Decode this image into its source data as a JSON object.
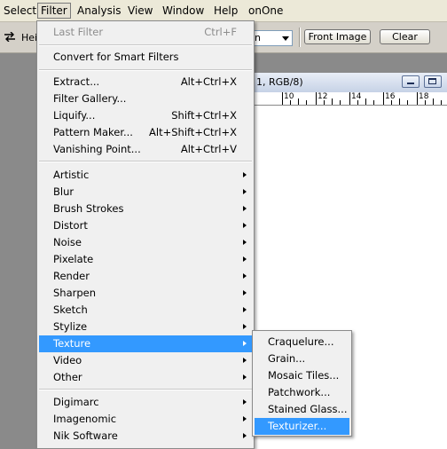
{
  "menubar": [
    "Select",
    "Filter",
    "Analysis",
    "View",
    "Window",
    "Help",
    "onOne"
  ],
  "options": {
    "label_partial": "Hei",
    "select_value_partial": "n",
    "front_image": "Front Image",
    "clear": "Clear"
  },
  "document": {
    "title_partial": "1, RGB/8)",
    "ruler_ticks": [
      "10",
      "12",
      "14",
      "16",
      "18"
    ]
  },
  "filter_menu": {
    "last_filter": {
      "label": "Last Filter",
      "shortcut": "Ctrl+F"
    },
    "convert": "Convert for Smart Filters",
    "group1": [
      {
        "label": "Extract...",
        "shortcut": "Alt+Ctrl+X"
      },
      {
        "label": "Filter Gallery...",
        "shortcut": ""
      },
      {
        "label": "Liquify...",
        "shortcut": "Shift+Ctrl+X"
      },
      {
        "label": "Pattern Maker...",
        "shortcut": "Alt+Shift+Ctrl+X"
      },
      {
        "label": "Vanishing Point...",
        "shortcut": "Alt+Ctrl+V"
      }
    ],
    "group2": [
      "Artistic",
      "Blur",
      "Brush Strokes",
      "Distort",
      "Noise",
      "Pixelate",
      "Render",
      "Sharpen",
      "Sketch",
      "Stylize",
      "Texture",
      "Video",
      "Other"
    ],
    "group3": [
      "Digimarc",
      "Imagenomic",
      "Nik Software"
    ]
  },
  "texture_submenu": [
    "Craquelure...",
    "Grain...",
    "Mosaic Tiles...",
    "Patchwork...",
    "Stained Glass...",
    "Texturizer..."
  ]
}
